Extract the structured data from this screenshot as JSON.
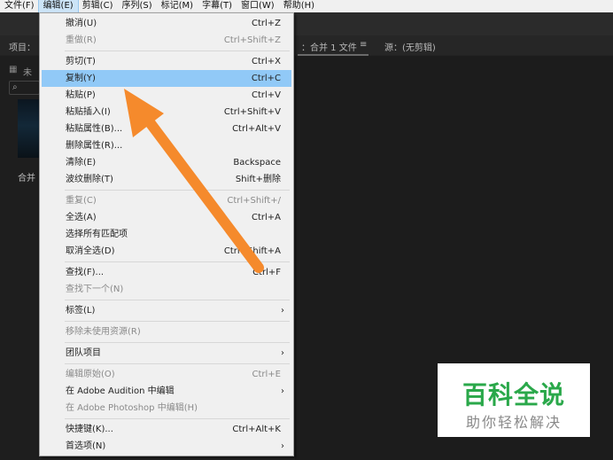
{
  "menubar": {
    "items": [
      {
        "label": "文件(F)"
      },
      {
        "label": "编辑(E)"
      },
      {
        "label": "剪辑(C)"
      },
      {
        "label": "序列(S)"
      },
      {
        "label": "标记(M)"
      },
      {
        "label": "字幕(T)"
      },
      {
        "label": "窗口(W)"
      },
      {
        "label": "帮助(H)"
      }
    ]
  },
  "panels": {
    "project_tab": "项目：",
    "sequence_tab": "：合并  1 文件",
    "menu_glyph": "≡",
    "source_tab": "源：(无剪辑)",
    "left_indicator": "未",
    "thumb_label": "合并"
  },
  "edit_menu": {
    "items": [
      {
        "label": "撤消(U)",
        "shortcut": "Ctrl+Z"
      },
      {
        "label": "重做(R)",
        "shortcut": "Ctrl+Shift+Z"
      },
      {
        "label": "剪切(T)",
        "shortcut": "Ctrl+X"
      },
      {
        "label": "复制(Y)",
        "shortcut": "Ctrl+C"
      },
      {
        "label": "粘贴(P)",
        "shortcut": "Ctrl+V"
      },
      {
        "label": "粘贴插入(I)",
        "shortcut": "Ctrl+Shift+V"
      },
      {
        "label": "粘贴属性(B)...",
        "shortcut": "Ctrl+Alt+V"
      },
      {
        "label": "删除属性(R)...",
        "shortcut": ""
      },
      {
        "label": "清除(E)",
        "shortcut": "Backspace"
      },
      {
        "label": "波纹删除(T)",
        "shortcut": "Shift+删除"
      },
      {
        "label": "重复(C)",
        "shortcut": "Ctrl+Shift+/"
      },
      {
        "label": "全选(A)",
        "shortcut": "Ctrl+A"
      },
      {
        "label": "选择所有匹配项",
        "shortcut": ""
      },
      {
        "label": "取消全选(D)",
        "shortcut": "Ctrl+Shift+A"
      },
      {
        "label": "查找(F)...",
        "shortcut": "Ctrl+F"
      },
      {
        "label": "查找下一个(N)",
        "shortcut": ""
      },
      {
        "label": "标签(L)",
        "shortcut": ""
      },
      {
        "label": "移除未使用资源(R)",
        "shortcut": ""
      },
      {
        "label": "团队项目",
        "shortcut": ""
      },
      {
        "label": "编辑原始(O)",
        "shortcut": "Ctrl+E"
      },
      {
        "label": "在 Adobe Audition 中编辑",
        "shortcut": ""
      },
      {
        "label": "在 Adobe Photoshop 中编辑(H)",
        "shortcut": ""
      },
      {
        "label": "快捷键(K)...",
        "shortcut": "Ctrl+Alt+K"
      },
      {
        "label": "首选项(N)",
        "shortcut": ""
      }
    ]
  },
  "watermark": {
    "line1": "百科全说",
    "line2": "助你轻松解决"
  },
  "colors": {
    "highlight": "#91c9f7",
    "annotation_arrow": "#f58a2c",
    "watermark_green": "#2aa84a"
  }
}
